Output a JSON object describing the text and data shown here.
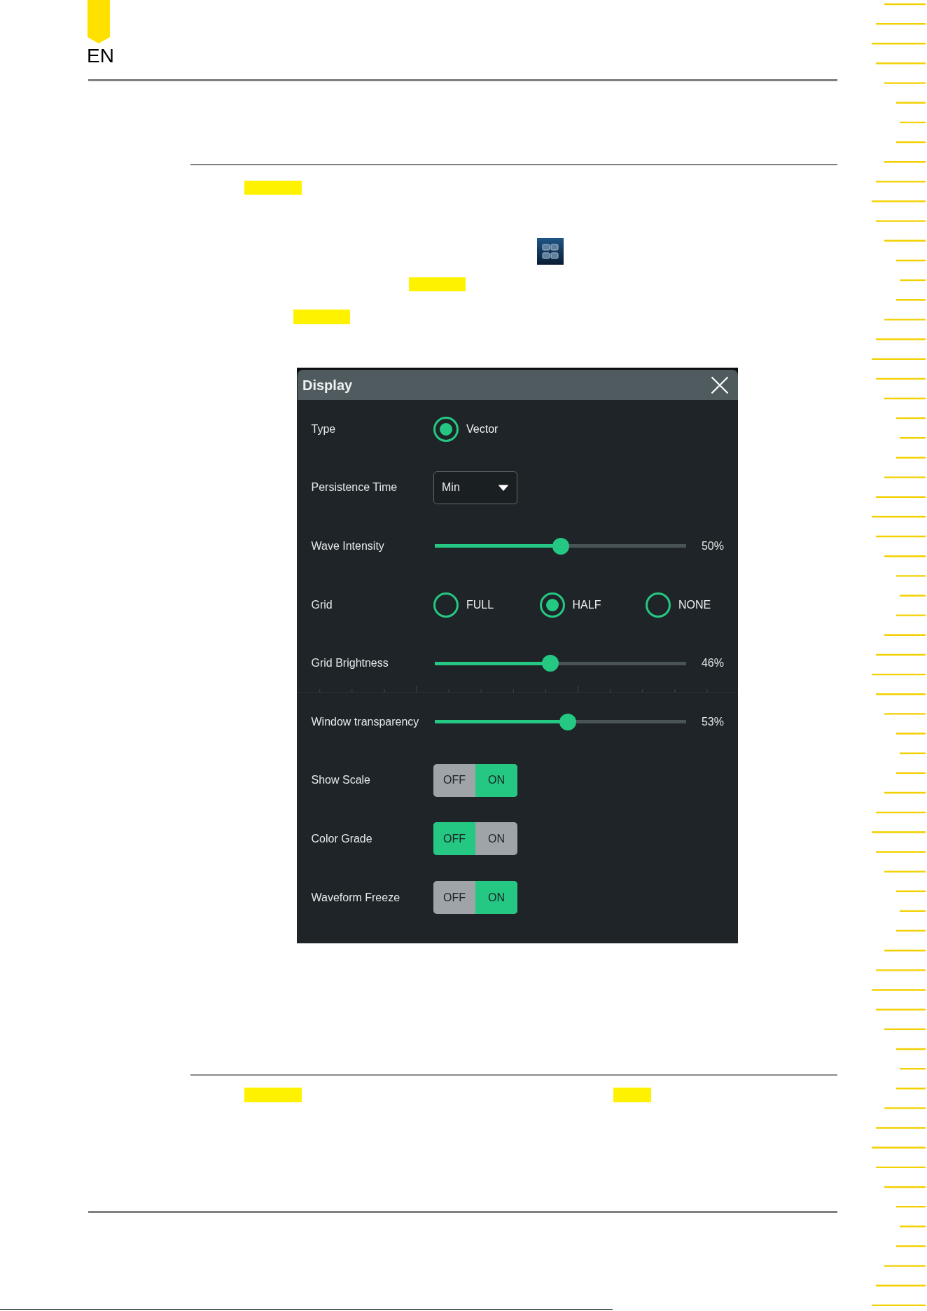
{
  "header": {
    "language": "EN"
  },
  "dialog": {
    "title": "Display",
    "rows": [
      {
        "kind": "radio",
        "label": "Type",
        "options": [
          {
            "label": "Vector",
            "selected": true
          }
        ]
      },
      {
        "kind": "dropdown",
        "label": "Persistence Time",
        "value": "Min"
      },
      {
        "kind": "slider",
        "label": "Wave Intensity",
        "level": 0.5,
        "reading": "50%"
      },
      {
        "kind": "radio",
        "label": "Grid",
        "options": [
          {
            "label": "FULL",
            "selected": false
          },
          {
            "label": "HALF",
            "selected": true
          },
          {
            "label": "NONE",
            "selected": false
          }
        ]
      },
      {
        "kind": "slider",
        "label": "Grid Brightness",
        "level": 0.46,
        "reading": "46%"
      },
      {
        "kind": "slider",
        "label": "Window transparency",
        "level": 0.53,
        "reading": "53%"
      },
      {
        "kind": "switch",
        "label": "Show Scale",
        "off_label": "OFF",
        "on_label": "ON",
        "on": true
      },
      {
        "kind": "switch",
        "label": "Color Grade",
        "off_label": "OFF",
        "on_label": "ON",
        "on": false
      },
      {
        "kind": "switch",
        "label": "Waveform Freeze",
        "off_label": "OFF",
        "on_label": "ON",
        "on": true
      }
    ]
  }
}
